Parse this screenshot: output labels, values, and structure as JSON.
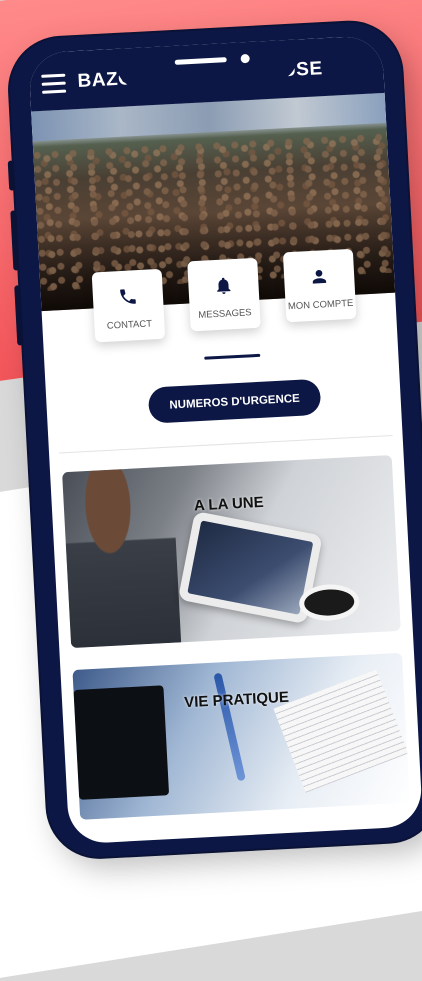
{
  "app": {
    "title": "BAZOUGES LA PEROUSE"
  },
  "quick_actions": [
    {
      "label": "CONTACT",
      "icon": "phone-icon"
    },
    {
      "label": "MESSAGES",
      "icon": "bell-icon"
    },
    {
      "label": "MON COMPTE",
      "icon": "user-icon"
    }
  ],
  "urgence": {
    "label": "NUMEROS D'URGENCE"
  },
  "cards": [
    {
      "title": "A LA UNE"
    },
    {
      "title": "VIE PRATIQUE"
    }
  ],
  "colors": {
    "primary": "#0d1745",
    "background_accent": "#f2555a"
  }
}
